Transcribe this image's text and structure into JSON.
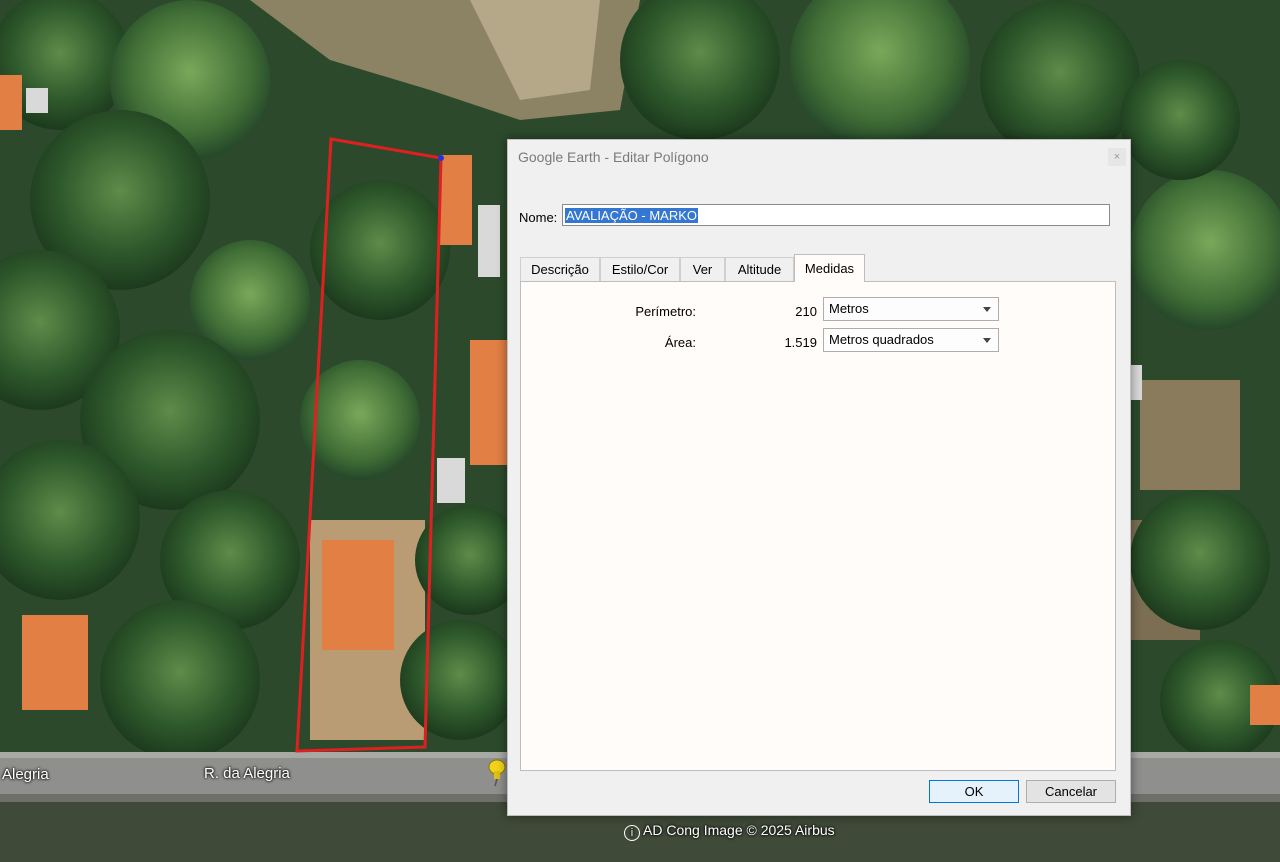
{
  "map": {
    "street_label_left": "Alegria",
    "street_label_main": "R. da Alegria",
    "copyright": "AD Cong Image © 2025 Airbus",
    "copyright_icon": "info-icon",
    "colors": {
      "polygon_outline": "#e02020",
      "roof": "#e27f45"
    }
  },
  "dialog": {
    "title": "Google Earth - Editar Polígono",
    "close_label": "×",
    "name_label": "Nome:",
    "name_value": "AVALIAÇÃO - MARKO",
    "tabs": [
      {
        "label": "Descrição"
      },
      {
        "label": "Estilo/Cor"
      },
      {
        "label": "Ver"
      },
      {
        "label": "Altitude"
      },
      {
        "label": "Medidas",
        "active": true
      }
    ],
    "measures": {
      "perimeter": {
        "label": "Perímetro:",
        "value": "210",
        "unit": "Metros"
      },
      "area": {
        "label": "Área:",
        "value": "1.519",
        "unit": "Metros quadrados"
      }
    },
    "ok_label": "OK",
    "cancel_label": "Cancelar"
  }
}
